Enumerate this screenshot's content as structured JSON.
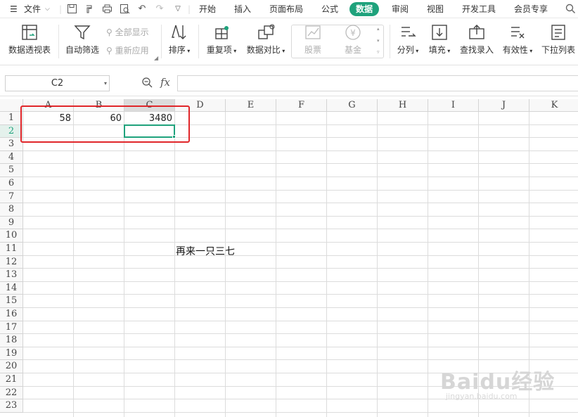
{
  "menubar": {
    "file_label": "文件",
    "tabs": [
      {
        "label": "开始"
      },
      {
        "label": "插入"
      },
      {
        "label": "页面布局"
      },
      {
        "label": "公式"
      },
      {
        "label": "数据"
      },
      {
        "label": "审阅"
      },
      {
        "label": "视图"
      },
      {
        "label": "开发工具"
      },
      {
        "label": "会员专享"
      }
    ],
    "active_tab": "数据"
  },
  "toolbar": {
    "pivot_table": "数据透视表",
    "auto_filter": "自动筛选",
    "show_all": "全部显示",
    "reapply": "重新应用",
    "sort": "排序",
    "duplicates": "重复项",
    "compare": "数据对比",
    "stocks": "股票",
    "fund": "基金",
    "split_columns": "分列",
    "fill": "填充",
    "lookup_entry": "查找录入",
    "validity": "有效性",
    "dropdown_list": "下拉列表"
  },
  "formula_bar": {
    "name_box": "C2",
    "fx_label": "fx",
    "formula": ""
  },
  "sheet": {
    "columns": [
      "A",
      "B",
      "C",
      "D",
      "E",
      "F",
      "G",
      "H",
      "I",
      "J",
      "K"
    ],
    "selected_column": "C",
    "rows": [
      "1",
      "2",
      "3",
      "4",
      "5",
      "6",
      "7",
      "8",
      "9",
      "10",
      "11",
      "12",
      "13",
      "14",
      "15",
      "16",
      "17",
      "18",
      "19",
      "20",
      "21",
      "22",
      "23"
    ],
    "selected_row": "2",
    "active_cell": "C2",
    "cells": {
      "A1": "58",
      "B1": "60",
      "C1": "3480",
      "D11": "再来一只三七"
    }
  },
  "watermark": {
    "text": "Baidu经验",
    "sub": "jingyan.baidu.com"
  },
  "colors": {
    "accent": "#1fa27c",
    "highlight_box": "#e0262a"
  }
}
